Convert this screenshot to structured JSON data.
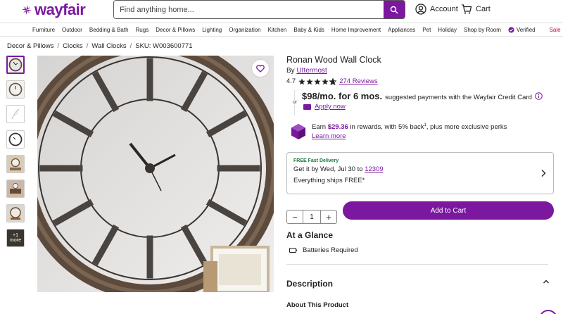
{
  "brand": {
    "logo_text": "wayfair",
    "color": "#7b189f"
  },
  "search": {
    "placeholder": "Find anything home..."
  },
  "header": {
    "account_label": "Account",
    "cart_label": "Cart"
  },
  "nav": {
    "items": [
      "Furniture",
      "Outdoor",
      "Bedding & Bath",
      "Rugs",
      "Decor & Pillows",
      "Lighting",
      "Organization",
      "Kitchen",
      "Baby & Kids",
      "Home Improvement",
      "Appliances",
      "Pet",
      "Holiday",
      "Shop by Room"
    ],
    "verified_label": "Verified",
    "sale_label": "Sale"
  },
  "breadcrumb": {
    "items": [
      "Decor & Pillows",
      "Clocks",
      "Wall Clocks"
    ],
    "sku": "SKU: W003600771"
  },
  "gallery": {
    "more_count": "+1",
    "more_label": "more"
  },
  "product": {
    "title": "Ronan Wood Wall Clock",
    "by_prefix": "By",
    "brand": "Uttermost",
    "rating": "4.7",
    "rating_value": 4.7,
    "reviews": "274 Reviews"
  },
  "finance": {
    "price": "$98/mo. for 6 mos.",
    "note": "suggested payments with the Wayfair Credit Card",
    "or_label": "or",
    "apply_label": "Apply now"
  },
  "rewards": {
    "prefix": "Earn",
    "amount": "$29.36",
    "text_mid": "in rewards, with 5% back",
    "superscript": "1",
    "text_end": ", plus more exclusive perks",
    "learn_more": "Learn more"
  },
  "delivery": {
    "tag": "FREE Fast Delivery",
    "line1_prefix": "Get it by Wed, Jul 30 to",
    "zip": "12309",
    "line2": "Everything ships FREE*"
  },
  "cart": {
    "quantity": "1",
    "add_label": "Add to Cart"
  },
  "glance": {
    "heading": "At a Glance",
    "batteries": "Batteries Required"
  },
  "description": {
    "heading": "Description",
    "about": "About This Product"
  }
}
